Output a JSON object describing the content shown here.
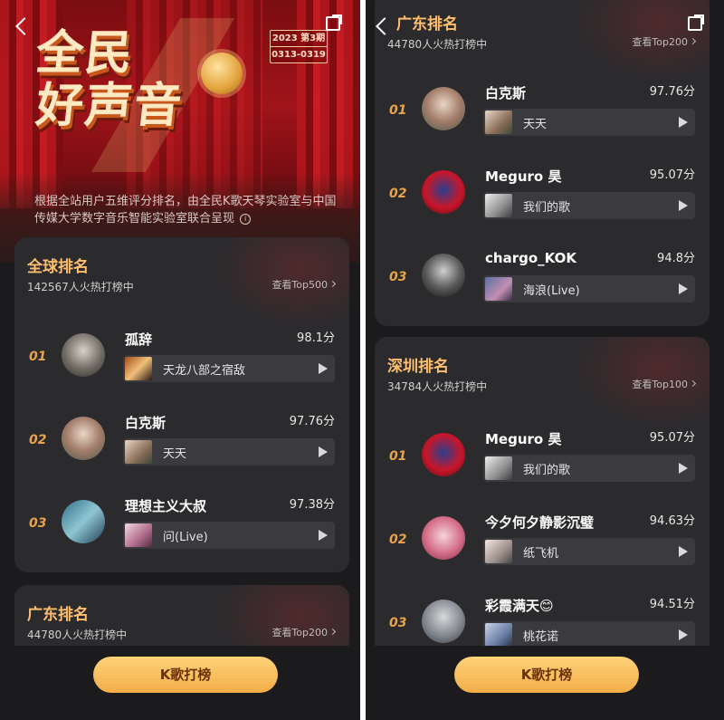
{
  "banner": {
    "title_line1": "全民",
    "title_line2": "好声音",
    "badge_year": "2023 第3期",
    "badge_dates": "0313-0319",
    "description": "根据全站用户五维评分排名，由全民K歌天琴实验室与中国传媒大学数字音乐智能实验室联合呈现",
    "info_glyph": "i"
  },
  "global_rank": {
    "title": "全球排名",
    "subtitle": "142567人火热打榜中",
    "more": "查看Top500",
    "entries": [
      {
        "rank": "01",
        "name": "孤辞",
        "score": "98.1分",
        "song": "天龙八部之宿敌"
      },
      {
        "rank": "02",
        "name": "白克斯",
        "score": "97.76分",
        "song": "天天"
      },
      {
        "rank": "03",
        "name": "理想主义大叔",
        "score": "97.38分",
        "song": "问(Live)"
      }
    ]
  },
  "guangdong_rank": {
    "title": "广东排名",
    "subtitle": "44780人火热打榜中",
    "more": "查看Top200",
    "entries": [
      {
        "rank": "01",
        "name": "白克斯",
        "score": "97.76分",
        "song": "天天"
      },
      {
        "rank": "02",
        "name": "Meguro 昊",
        "score": "95.07分",
        "song": "我们的歌"
      },
      {
        "rank": "03",
        "name": "chargo_KOK",
        "score": "94.8分",
        "song": "海浪(Live)"
      }
    ]
  },
  "shenzhen_rank": {
    "title": "深圳排名",
    "subtitle": "34784人火热打榜中",
    "more": "查看Top100",
    "entries": [
      {
        "rank": "01",
        "name": "Meguro 昊",
        "score": "95.07分",
        "song": "我们的歌"
      },
      {
        "rank": "02",
        "name": "今夕何夕静影沉璧",
        "score": "94.63分",
        "song": "纸飞机"
      },
      {
        "rank": "03",
        "name": "彩霞满天😊",
        "score": "94.51分",
        "song": "桃花诺"
      }
    ]
  },
  "bottom": {
    "cta_label": "K歌打榜"
  },
  "colors": {
    "accent": "#ffbf6e",
    "rank": "#e8a44d",
    "cta": "#f3ad48",
    "card": "#2b2a2d"
  }
}
